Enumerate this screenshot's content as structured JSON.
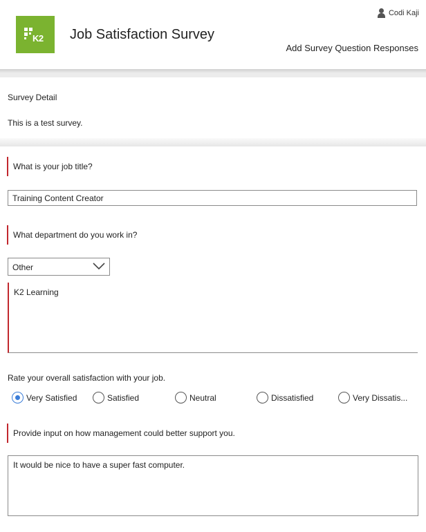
{
  "header": {
    "logo_text": "K2",
    "title": "Job Satisfaction Survey",
    "user_name": "Codi Kaji",
    "add_link": "Add Survey Question Responses"
  },
  "detail": {
    "title": "Survey Detail",
    "text": "This is a test survey."
  },
  "questions": {
    "q1": {
      "label": "What is your job title?",
      "value": "Training Content Creator"
    },
    "q2": {
      "label": "What department do you work in?",
      "selected": "Other",
      "other_value": "K2 Learning"
    },
    "q3": {
      "label": "Rate your overall satisfaction with your job.",
      "options": [
        "Very Satisfied",
        "Satisfied",
        "Neutral",
        "Dissatisfied",
        "Very Dissatis..."
      ],
      "selected_index": 0
    },
    "q4": {
      "label": "Provide input on how management could better support you.",
      "value": "It would be nice to have a super fast computer."
    }
  },
  "colors": {
    "brand": "#7bb330",
    "required": "#c1272d",
    "radio_selected": "#3b7dd8"
  },
  "icons": [
    "user-icon",
    "chevron-down-icon"
  ]
}
